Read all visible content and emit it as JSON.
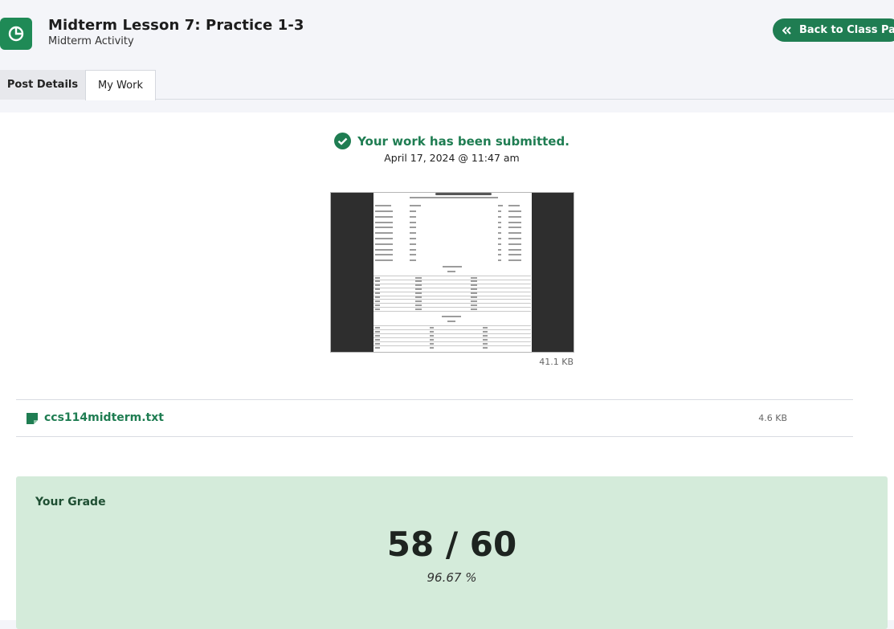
{
  "header": {
    "title": "Midterm Lesson 7: Practice 1-3",
    "subtitle": "Midterm Activity",
    "back_label": "Back to Class Page"
  },
  "tabs": [
    {
      "label": "Post Details",
      "active": false
    },
    {
      "label": "My Work",
      "active": true
    }
  ],
  "submission": {
    "status": "Your work has been submitted.",
    "date": "April 17, 2024 @ 11:47 am"
  },
  "attachment_image": {
    "size": "41.1 KB"
  },
  "attachment_file": {
    "name": "ccs114midterm.txt",
    "size": "4.6 KB"
  },
  "grade": {
    "title": "Your Grade",
    "score": "58 / 60",
    "percent": "96.67 %"
  },
  "colors": {
    "accent": "#1f7d52",
    "grade_bg": "#d4ebda"
  }
}
